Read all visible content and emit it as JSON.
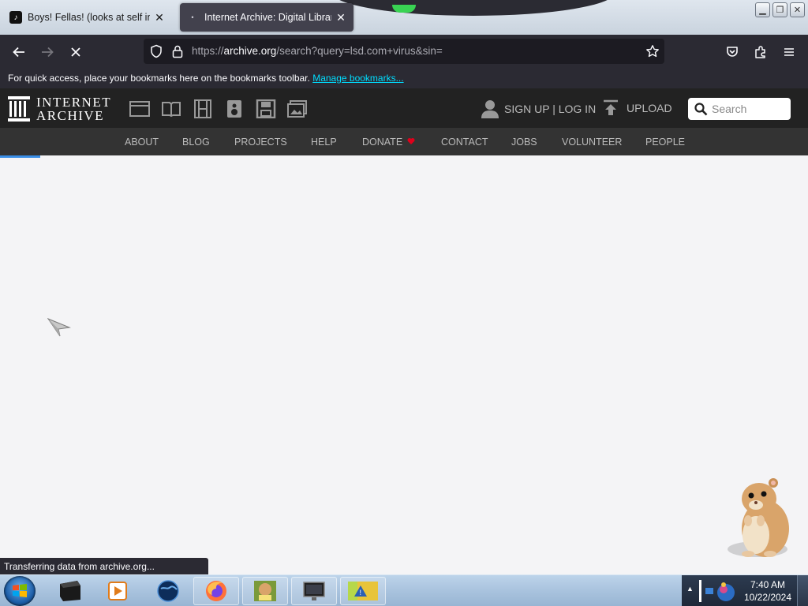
{
  "browser": {
    "tabs": [
      {
        "title": "Boys! Fellas! (looks at self in camera)",
        "icon": "tiktok-icon",
        "active": false
      },
      {
        "title": "Internet Archive: Digital Library",
        "icon": "loading-dot-icon",
        "active": true
      }
    ],
    "url_prefix": "https://",
    "url_domain": "archive.org",
    "url_path": "/search?query=lsd.com+virus&sin=",
    "bookmarks_text": "For quick access, place your bookmarks here on the bookmarks toolbar.",
    "bookmarks_link": "Manage bookmarks...",
    "status": "Transferring data from archive.org..."
  },
  "ia": {
    "logo_line1": "INTERNET",
    "logo_line2": "ARCHIVE",
    "media_icons": [
      "web-icon",
      "texts-icon",
      "video-icon",
      "audio-icon",
      "software-icon",
      "images-icon"
    ],
    "account": "SIGN UP | LOG IN",
    "upload": "UPLOAD",
    "search_placeholder": "Search",
    "nav": [
      "ABOUT",
      "BLOG",
      "PROJECTS",
      "HELP",
      "DONATE",
      "CONTACT",
      "JOBS",
      "VOLUNTEER",
      "PEOPLE"
    ],
    "donate_heart_color": "#e0001b"
  },
  "taskbar": {
    "time": "7:40 AM",
    "date": "10/22/2024"
  },
  "colors": {
    "browser_chrome": "#2b2a33",
    "ia_header": "#222222",
    "ia_nav": "#333333",
    "link_accent": "#00ddff"
  }
}
